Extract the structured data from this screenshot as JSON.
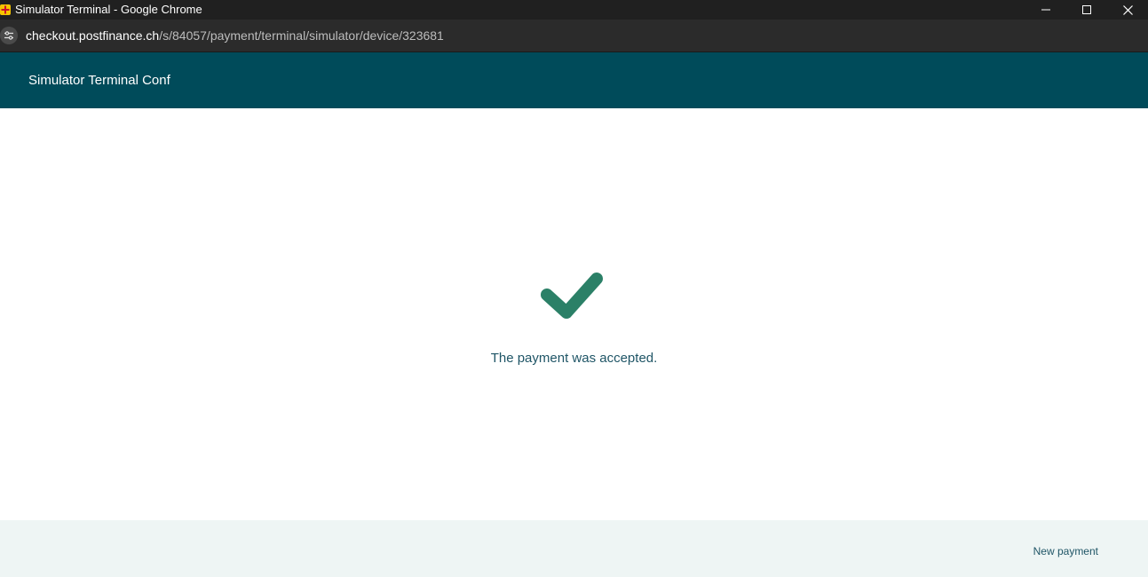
{
  "browser": {
    "window_title": "Simulator Terminal - Google Chrome",
    "url_host": "checkout.postfinance.ch",
    "url_path": "/s/84057/payment/terminal/simulator/device/323681"
  },
  "header": {
    "title": "Simulator Terminal Conf"
  },
  "main": {
    "status_icon": "checkmark-icon",
    "message": "The payment was accepted."
  },
  "footer": {
    "new_payment_label": "New payment"
  },
  "colors": {
    "header_bg": "#004b5a",
    "checkmark": "#2b8067",
    "message_text": "#1f5566",
    "footer_bg": "#eef5f4"
  }
}
